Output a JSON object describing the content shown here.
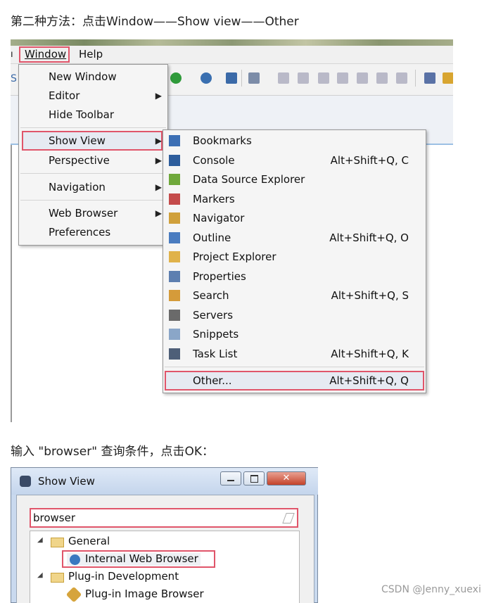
{
  "instructions": {
    "step2": "第二种方法：点击Window——Show view——Other",
    "step3": "输入 \"browser\" 查询条件，点击OK："
  },
  "menubar": {
    "window": "Window",
    "help": "Help"
  },
  "window_menu": {
    "items": [
      {
        "label": "New Window"
      },
      {
        "label": "Editor"
      },
      {
        "label": "Hide Toolbar"
      },
      {
        "label": "Show View"
      },
      {
        "label": "Perspective"
      },
      {
        "label": "Navigation"
      },
      {
        "label": "Web Browser"
      },
      {
        "label": "Preferences"
      }
    ]
  },
  "show_view_menu": {
    "items": [
      {
        "label": "Bookmarks",
        "shortcut": ""
      },
      {
        "label": "Console",
        "shortcut": "Alt+Shift+Q, C"
      },
      {
        "label": "Data Source Explorer",
        "shortcut": ""
      },
      {
        "label": "Markers",
        "shortcut": ""
      },
      {
        "label": "Navigator",
        "shortcut": ""
      },
      {
        "label": "Outline",
        "shortcut": "Alt+Shift+Q, O"
      },
      {
        "label": "Project Explorer",
        "shortcut": ""
      },
      {
        "label": "Properties",
        "shortcut": ""
      },
      {
        "label": "Search",
        "shortcut": "Alt+Shift+Q, S"
      },
      {
        "label": "Servers",
        "shortcut": ""
      },
      {
        "label": "Snippets",
        "shortcut": ""
      },
      {
        "label": "Task List",
        "shortcut": "Alt+Shift+Q, K"
      },
      {
        "label": "Other...",
        "shortcut": "Alt+Shift+Q, Q"
      }
    ]
  },
  "dialog": {
    "title": "Show View",
    "search_value": "browser",
    "tree": [
      {
        "label": "General"
      },
      {
        "label": "Internal Web Browser"
      },
      {
        "label": "Plug-in Development"
      },
      {
        "label": "Plug-in Image Browser"
      }
    ]
  },
  "watermark": "CSDN @Jenny_xuexi",
  "colors": {
    "highlight_border": "#e0556a",
    "tab_line": "#9cc0e4"
  }
}
